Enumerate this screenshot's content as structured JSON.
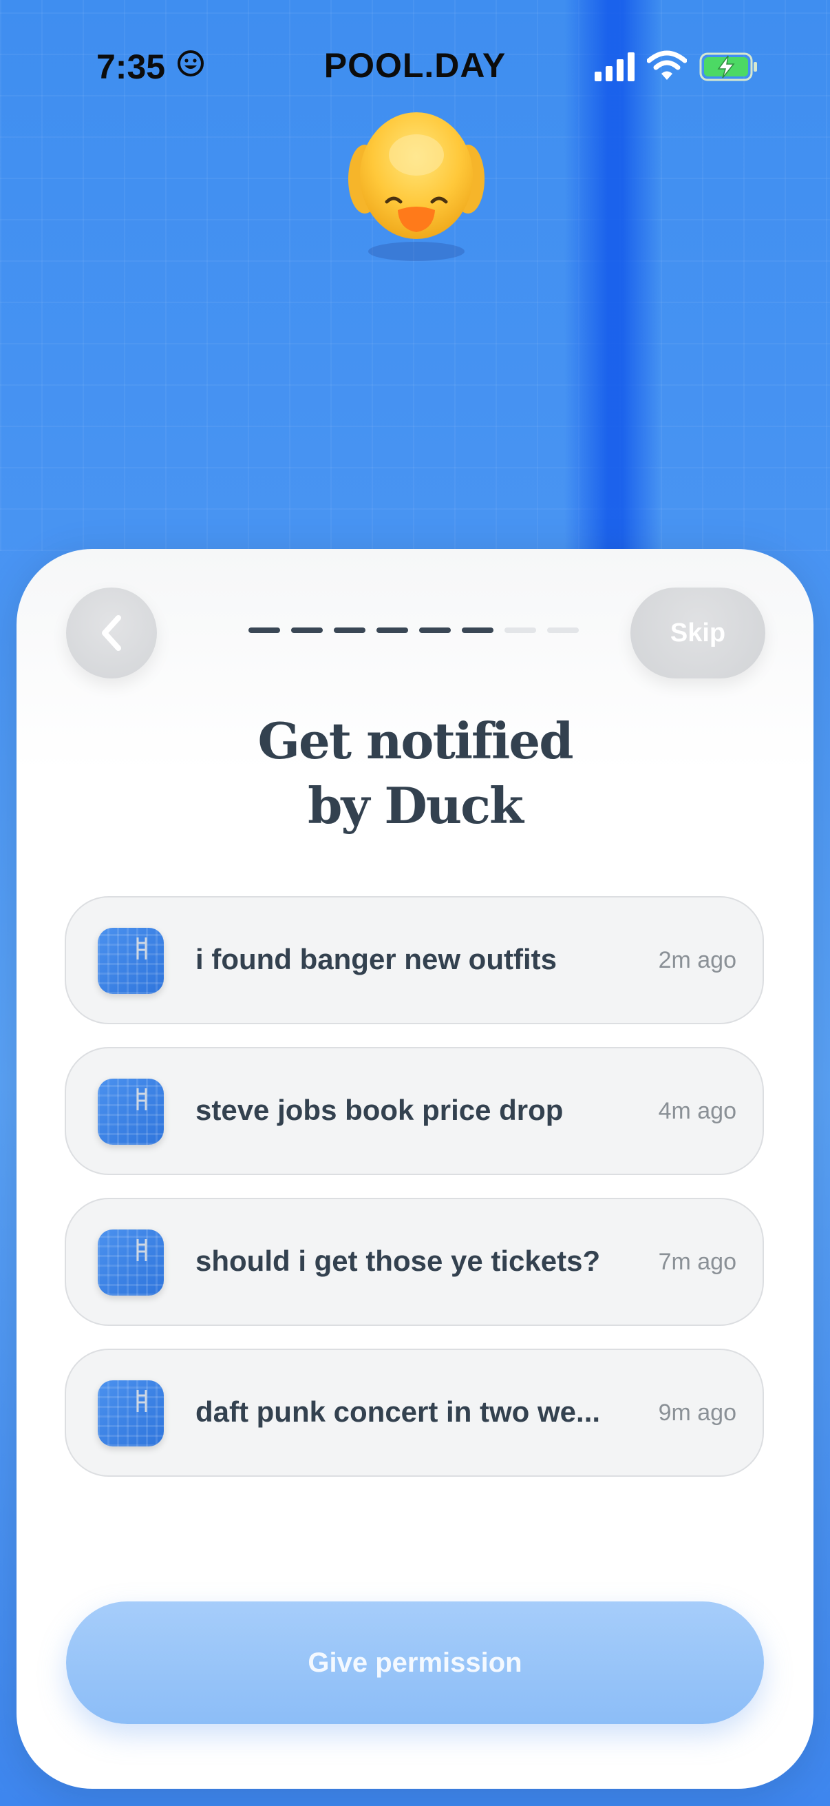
{
  "status_bar": {
    "time": "7:35",
    "time_emoji_icon": "smiley-face-icon",
    "app_title": "POOL.DAY",
    "signal_icon": "cellular-signal-icon",
    "wifi_icon": "wifi-icon",
    "battery_icon": "battery-charging-icon"
  },
  "header": {
    "back_icon": "chevron-left-icon",
    "progress": {
      "total_steps": 8,
      "completed_steps": 6
    },
    "skip_label": "Skip"
  },
  "title": {
    "line1": "Get notified",
    "line2": "by Duck"
  },
  "notifications": [
    {
      "text": "i found banger new outfits",
      "time": "2m ago"
    },
    {
      "text": "steve jobs book price drop",
      "time": "4m ago"
    },
    {
      "text": "should i get those ye tickets?",
      "time": "7m ago"
    },
    {
      "text": "daft punk concert in two we...",
      "time": "9m ago"
    }
  ],
  "cta": {
    "label": "Give permission"
  },
  "colors": {
    "accent_blue": "#8cbdf7",
    "pool_blue": "#4a95f3",
    "text_dark": "#33414f",
    "progress_active": "#3a4755",
    "progress_inactive": "#e3e5e8"
  }
}
